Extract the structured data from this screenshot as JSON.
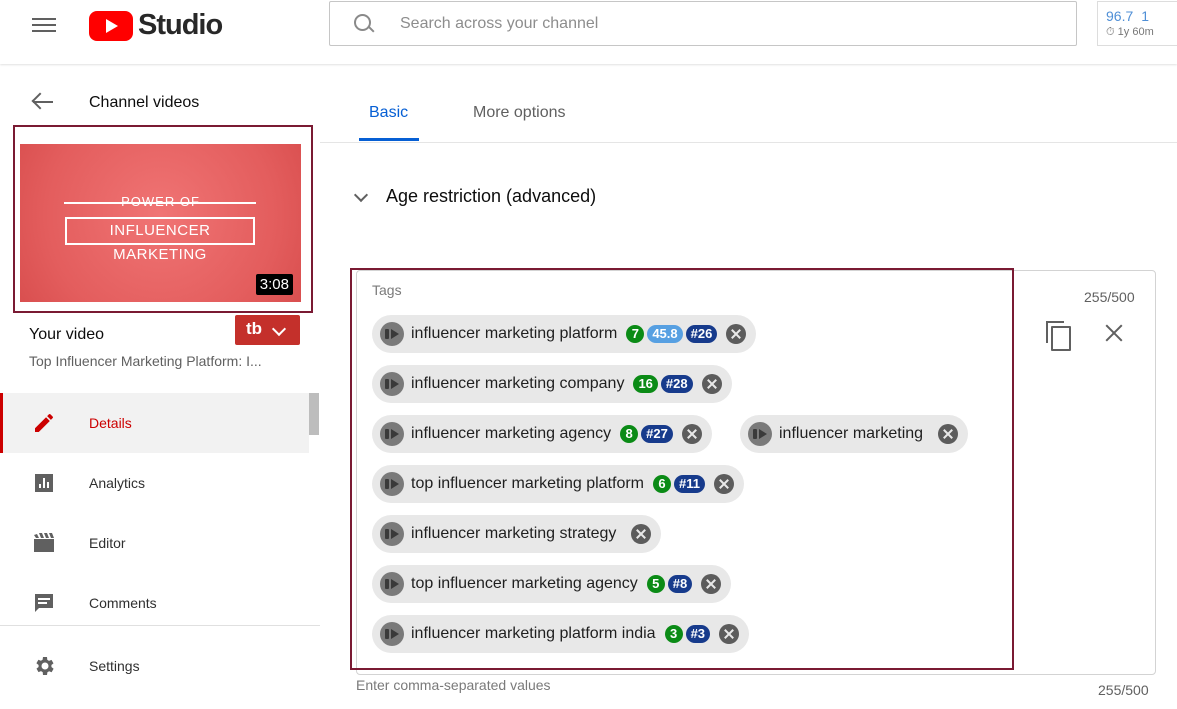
{
  "header": {
    "logo_text": "Studio",
    "search_placeholder": "Search across your channel",
    "stats_value_1": "96.7",
    "stats_value_2": "1",
    "stats_period_1": "⏱ 1y",
    "stats_period_2": "60m"
  },
  "sidebar": {
    "back_label": "Channel videos",
    "thumbnail_line1": "POWER OF",
    "thumbnail_line2": "INFLUENCER MARKETING",
    "duration": "3:08",
    "your_video_label": "Your video",
    "video_title": "Top Influencer Marketing Platform: I...",
    "tb_label": "tb",
    "nav": [
      {
        "label": "Details",
        "icon": "pencil-icon"
      },
      {
        "label": "Analytics",
        "icon": "analytics-icon"
      },
      {
        "label": "Editor",
        "icon": "clapperboard-icon"
      },
      {
        "label": "Comments",
        "icon": "comment-icon"
      },
      {
        "label": "Settings",
        "icon": "gear-icon"
      }
    ]
  },
  "tabs": [
    {
      "label": "Basic"
    },
    {
      "label": "More options"
    }
  ],
  "age_restriction_label": "Age restriction (advanced)",
  "tags": {
    "label": "Tags",
    "count": "255/500",
    "hint": "Enter comma-separated values",
    "count_bottom": "255/500",
    "items": [
      {
        "text": "influencer marketing platform",
        "score": "7",
        "volume": "45.8",
        "rank": "#26"
      },
      {
        "text": "influencer marketing company",
        "score": "16",
        "rank": "#28"
      },
      {
        "text": "influencer marketing agency",
        "score": "8",
        "rank": "#27"
      },
      {
        "text": "influencer marketing"
      },
      {
        "text": "top influencer marketing platform",
        "score": "6",
        "rank": "#11"
      },
      {
        "text": "influencer marketing strategy"
      },
      {
        "text": "top influencer marketing agency",
        "score": "5",
        "rank": "#8"
      },
      {
        "text": "influencer marketing platform india",
        "score": "3",
        "rank": "#3"
      }
    ]
  },
  "colors": {
    "accent": "#065fd4",
    "active_nav": "#cc0000",
    "highlight_frame": "#7a1a33",
    "score_green": "#0b8b16",
    "rank_navy": "#173b8c",
    "volume_blue": "#57a0e2"
  }
}
